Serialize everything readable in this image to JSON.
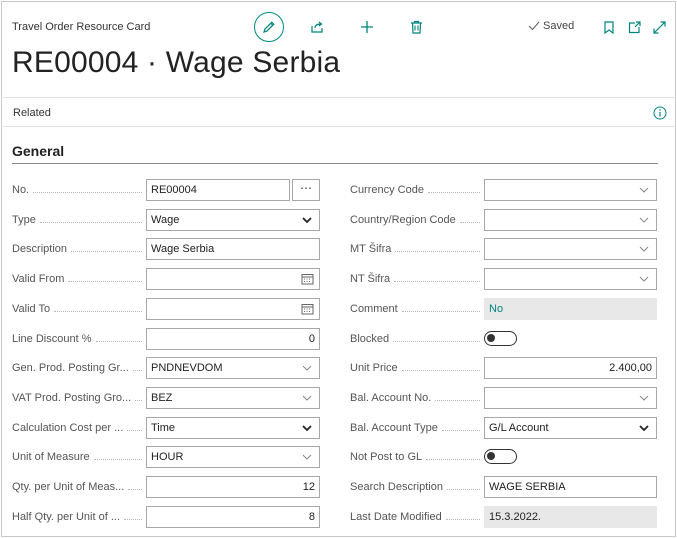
{
  "header": {
    "card_type": "Travel Order Resource Card",
    "title": "RE00004 · Wage Serbia",
    "saved_label": "Saved",
    "icons": [
      "edit-icon",
      "share-icon",
      "plus-icon",
      "trash-icon",
      "check-icon",
      "bookmark-icon",
      "open-new-window-icon",
      "expand-icon"
    ],
    "accent_color": "#00857d"
  },
  "related": {
    "label": "Related",
    "icon": "info-icon"
  },
  "general": {
    "title": "General",
    "left": [
      {
        "label": "No.",
        "value": "RE00004",
        "kind": "text-assist"
      },
      {
        "label": "Type",
        "value": "Wage",
        "kind": "select"
      },
      {
        "label": "Description",
        "value": "Wage Serbia",
        "kind": "text"
      },
      {
        "label": "Valid From",
        "value": "",
        "kind": "date"
      },
      {
        "label": "Valid To",
        "value": "",
        "kind": "date"
      },
      {
        "label": "Line Discount %",
        "value": "0",
        "kind": "number"
      },
      {
        "label": "Gen. Prod. Posting Gr...",
        "value": "PNDNEVDOM",
        "kind": "lookup"
      },
      {
        "label": "VAT Prod. Posting Gro...",
        "value": "BEZ",
        "kind": "lookup"
      },
      {
        "label": "Calculation Cost per ...",
        "value": "Time",
        "kind": "select"
      },
      {
        "label": "Unit of Measure",
        "value": "HOUR",
        "kind": "lookup"
      },
      {
        "label": "Qty. per Unit of Meas...",
        "value": "12",
        "kind": "number"
      },
      {
        "label": "Half Qty. per Unit of ...",
        "value": "8",
        "kind": "number"
      }
    ],
    "right": [
      {
        "label": "Currency Code",
        "value": "",
        "kind": "lookup"
      },
      {
        "label": "Country/Region Code",
        "value": "",
        "kind": "lookup"
      },
      {
        "label": "MT Šifra",
        "value": "",
        "kind": "lookup"
      },
      {
        "label": "NT Šifra",
        "value": "",
        "kind": "lookup"
      },
      {
        "label": "Comment",
        "value": "No",
        "kind": "readonly-accent"
      },
      {
        "label": "Blocked",
        "value": false,
        "kind": "toggle"
      },
      {
        "label": "Unit Price",
        "value": "2.400,00",
        "kind": "number"
      },
      {
        "label": "Bal. Account No.",
        "value": "",
        "kind": "lookup"
      },
      {
        "label": "Bal. Account Type",
        "value": "G/L Account",
        "kind": "select"
      },
      {
        "label": "Not Post to GL",
        "value": false,
        "kind": "toggle"
      },
      {
        "label": "Search Description",
        "value": "WAGE SERBIA",
        "kind": "text"
      },
      {
        "label": "Last Date Modified",
        "value": "15.3.2022.",
        "kind": "readonly"
      }
    ]
  }
}
